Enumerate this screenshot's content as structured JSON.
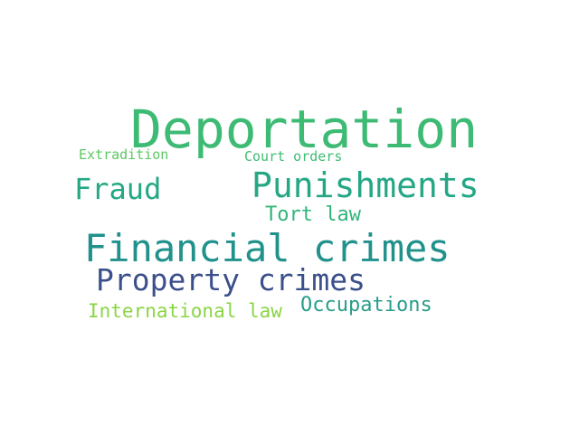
{
  "word_cloud": {
    "words": [
      {
        "text": "Deportation",
        "color": "#3dbb74"
      },
      {
        "text": "Extradition",
        "color": "#5cc863"
      },
      {
        "text": "Court orders",
        "color": "#3ebc73"
      },
      {
        "text": "Fraud",
        "color": "#24a884"
      },
      {
        "text": "Punishments",
        "color": "#25a785"
      },
      {
        "text": "Tort law",
        "color": "#31b57b"
      },
      {
        "text": "Financial crimes",
        "color": "#21918c"
      },
      {
        "text": "Property crimes",
        "color": "#3b4f8a"
      },
      {
        "text": "International law",
        "color": "#8ad546"
      },
      {
        "text": "Occupations",
        "color": "#2a9d8a"
      }
    ]
  }
}
